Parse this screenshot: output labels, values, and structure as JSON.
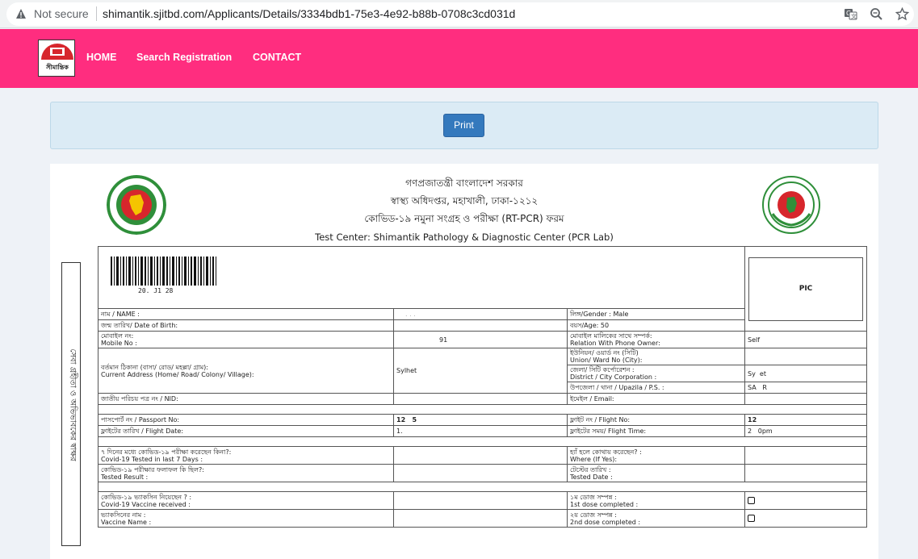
{
  "browser": {
    "security_label": "Not secure",
    "url": "shimantik.sjitbd.com/Applicants/Details/3334bdb1-75e3-4e92-b88b-0708c3cd031d"
  },
  "nav": {
    "logo_text": "সীমান্তিক",
    "items": [
      "HOME",
      "Search Registration",
      "CONTACT"
    ]
  },
  "print_label": "Print",
  "header": {
    "line1": "গণপ্রজাতন্ত্রী বাংলাদেশ সরকার",
    "line2": "স্বাস্থ্য অধিদপ্তর, মহাখালী, ঢাকা-১২১২",
    "line3": "কোভিড-১৯ নমুনা সংগ্রহ ও পরীক্ষা (RT-PCR) ফরম",
    "test_center": "Test Center: Shimantik Pathology & Diagnostic Center (PCR Lab)"
  },
  "side_label": "সেবা গ্রহীতা ও অভিভাবকের স্বাক্ষর",
  "barcode_text": "20. J1 28",
  "pic_label": "PIC",
  "rows": {
    "name_label": "নাম / NAME :",
    "name_value": ". . .",
    "gender_label": "লিঙ্গ/Gender : Male",
    "dob_label": "জন্ম তারিখ/ Date of Birth:",
    "age_label": "বয়স/Age: 50",
    "mobile_bn": "মোবাইল নং:",
    "mobile_en": "Mobile No :",
    "mobile_value": "91",
    "relation_bn": "মোবাইল মালিকের সাথে সম্পর্ক:",
    "relation_en": "Relation With Phone Owner:",
    "relation_value": "Self",
    "union_bn": "ইউনিয়ন/ ওয়ার্ড নং (সিটি)",
    "union_en": "Union/ Ward No (City):",
    "address_bn": "বর্তমান ঠিকানা (বাসা/ রোড/ মহল্লা/ গ্রাম):",
    "address_en": "Current Address (Home/ Road/ Colony/ Village):",
    "address_value": "Sylhet",
    "district_bn": "জেলা/ সিটি কর্পোরেশন :",
    "district_en": "District / City Corporation :",
    "district_value": "Sy  et",
    "upazila_label": "উপজেলা / থানা / Upazila / P.S. :",
    "upazila_value": "SA   R",
    "nid_label": "জাতীয় পরিচয় পত্র নং / NID:",
    "email_label": "ইমেইল / Email:",
    "passport_label": "পাসপোর্ট নং / Passport No:",
    "passport_value": "12   5",
    "flight_label": "ফ্লাইট নং / Flight No:",
    "flight_value": "12",
    "flight_date_label": "ফ্লাইটের তারিখ / Flight Date:",
    "flight_date_value": "1.",
    "flight_time_label": "ফ্লাইটের সময়/ Flight Time:",
    "flight_time_value": "2   0pm",
    "tested7_bn": "৭ দিনের মধ্যে কোভিড-১৯ পরীক্ষা করেছেন কিনা?:",
    "tested7_en": "Covid-19 Tested in last 7 Days :",
    "where_bn": "হ্যাঁ হলে কোথায় করেছেন? :",
    "where_en": "Where (If Yes):",
    "result_bn": "কোভিড-১৯ পরীক্ষার ফলাফল কি ছিল?:",
    "result_en": "Tested Result :",
    "tested_date_bn": "টেস্টের তারিখ :",
    "tested_date_en": "Tested Date :",
    "vaccine_bn": "কোভিড-১৯ ভ্যাকসিন নিয়েছেন ? :",
    "vaccine_en": "Covid-19 Vaccine received :",
    "dose1_bn": "১ম ডোজ সম্পন্ন :",
    "dose1_en": "1st dose completed :",
    "vname_bn": "ভ্যাকসিনের নাম :",
    "vname_en": "Vaccine Name :",
    "dose2_bn": "২য় ডোজ সম্পন্ন :",
    "dose2_en": "2nd dose completed :"
  },
  "colors": {
    "nav_bg": "#ff2d7f",
    "print_button": "#3479bd",
    "panel_bg": "#dbebf5"
  }
}
